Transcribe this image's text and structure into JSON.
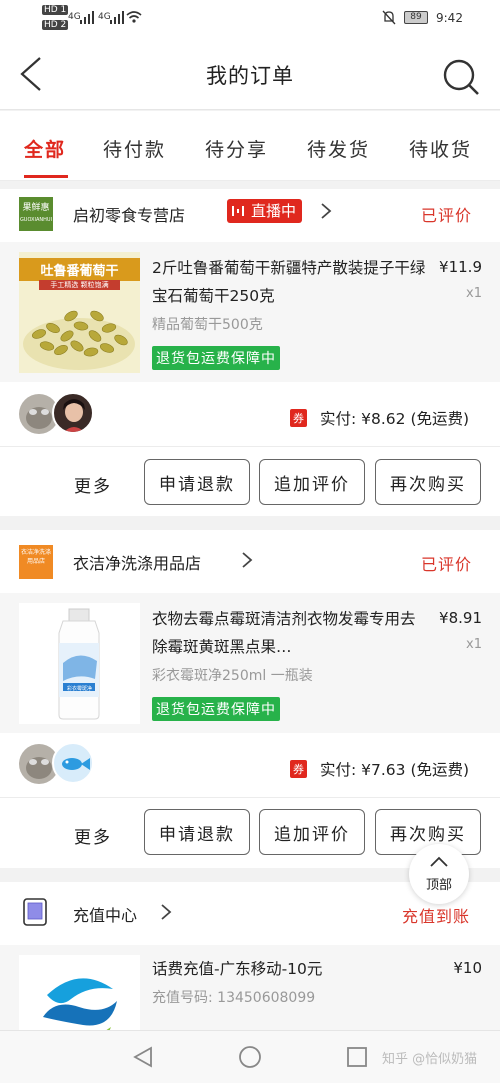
{
  "status_bar": {
    "left_icons": [
      "HD 1",
      "HD 2",
      "4G",
      "4G"
    ],
    "battery": "89",
    "time": "9:42"
  },
  "header": {
    "title": "我的订单"
  },
  "tabs": [
    "全部",
    "待付款",
    "待分享",
    "待发货",
    "待收货"
  ],
  "orders": [
    {
      "shop_logo_text": "果鲜惠",
      "shop_logo_sub": "GUOXIANHUI",
      "shop_name": "启初零食专营店",
      "live_badge": "直播中",
      "status": "已评价",
      "product": {
        "thumb_title": "吐鲁番葡萄干",
        "thumb_sub": "手工精选 颗粒饱满",
        "title": "2斤吐鲁番葡萄干新疆特产散装提子干绿宝石葡萄干250克",
        "spec": "精品葡萄干500克",
        "price": "¥11.9",
        "qty": "x1",
        "guarantee": "退货包运费保障中"
      },
      "coupon": "券",
      "pay_text": "实付: ¥8.62 (免运费)",
      "more": "更多",
      "buttons": [
        "申请退款",
        "追加评价",
        "再次购买"
      ]
    },
    {
      "shop_logo_text": "衣洁净洗涤用品店",
      "shop_name": "衣洁净洗涤用品店",
      "status": "已评价",
      "product": {
        "thumb_title": "彩衣霉斑净",
        "title": "衣物去霉点霉斑清洁剂衣物发霉专用去除霉斑黄斑黑点果…",
        "spec": "彩衣霉斑净250ml 一瓶装",
        "price": "¥8.91",
        "qty": "x1",
        "guarantee": "退货包运费保障中"
      },
      "coupon": "券",
      "pay_text": "实付: ¥7.63 (免运费)",
      "more": "更多",
      "buttons": [
        "申请退款",
        "追加评价",
        "再次购买"
      ]
    },
    {
      "shop_name": "充值中心",
      "status": "充值到账",
      "product": {
        "title": "话费充值-广东移动-10元",
        "spec": "充值号码: 13450608099",
        "price": "¥10"
      }
    }
  ],
  "float_button": {
    "label": "顶部"
  },
  "watermark": "知乎 @恰似奶猫",
  "colors": {
    "accent": "#e0281e",
    "guarantee": "#27b24a"
  }
}
